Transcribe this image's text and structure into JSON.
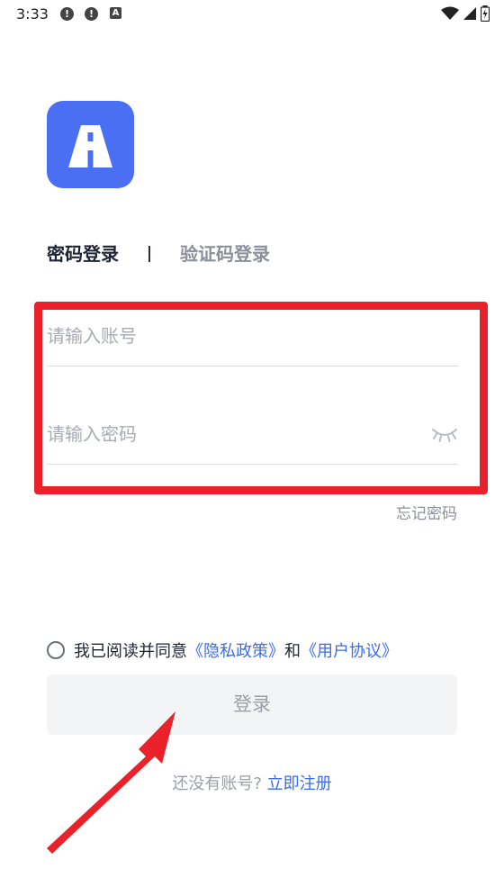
{
  "status_bar": {
    "time": "3:33",
    "notif1": "!",
    "notif2": "!",
    "a_badge": "A"
  },
  "login": {
    "tab_password": "密码登录",
    "tab_code": "验证码登录",
    "account_placeholder": "请输入账号",
    "password_placeholder": "请输入密码",
    "forgot": "忘记密码",
    "agree_prefix": "我已阅读并同意",
    "privacy_link": "《隐私政策》",
    "and": "和",
    "user_agreement_link": "《用户协议》",
    "login_button": "登录",
    "no_account": "还没有账号?",
    "register_link": "立即注册"
  },
  "colors": {
    "accent": "#3a6bf0",
    "logo": "#4a6ff3",
    "highlight": "#e8212b"
  }
}
